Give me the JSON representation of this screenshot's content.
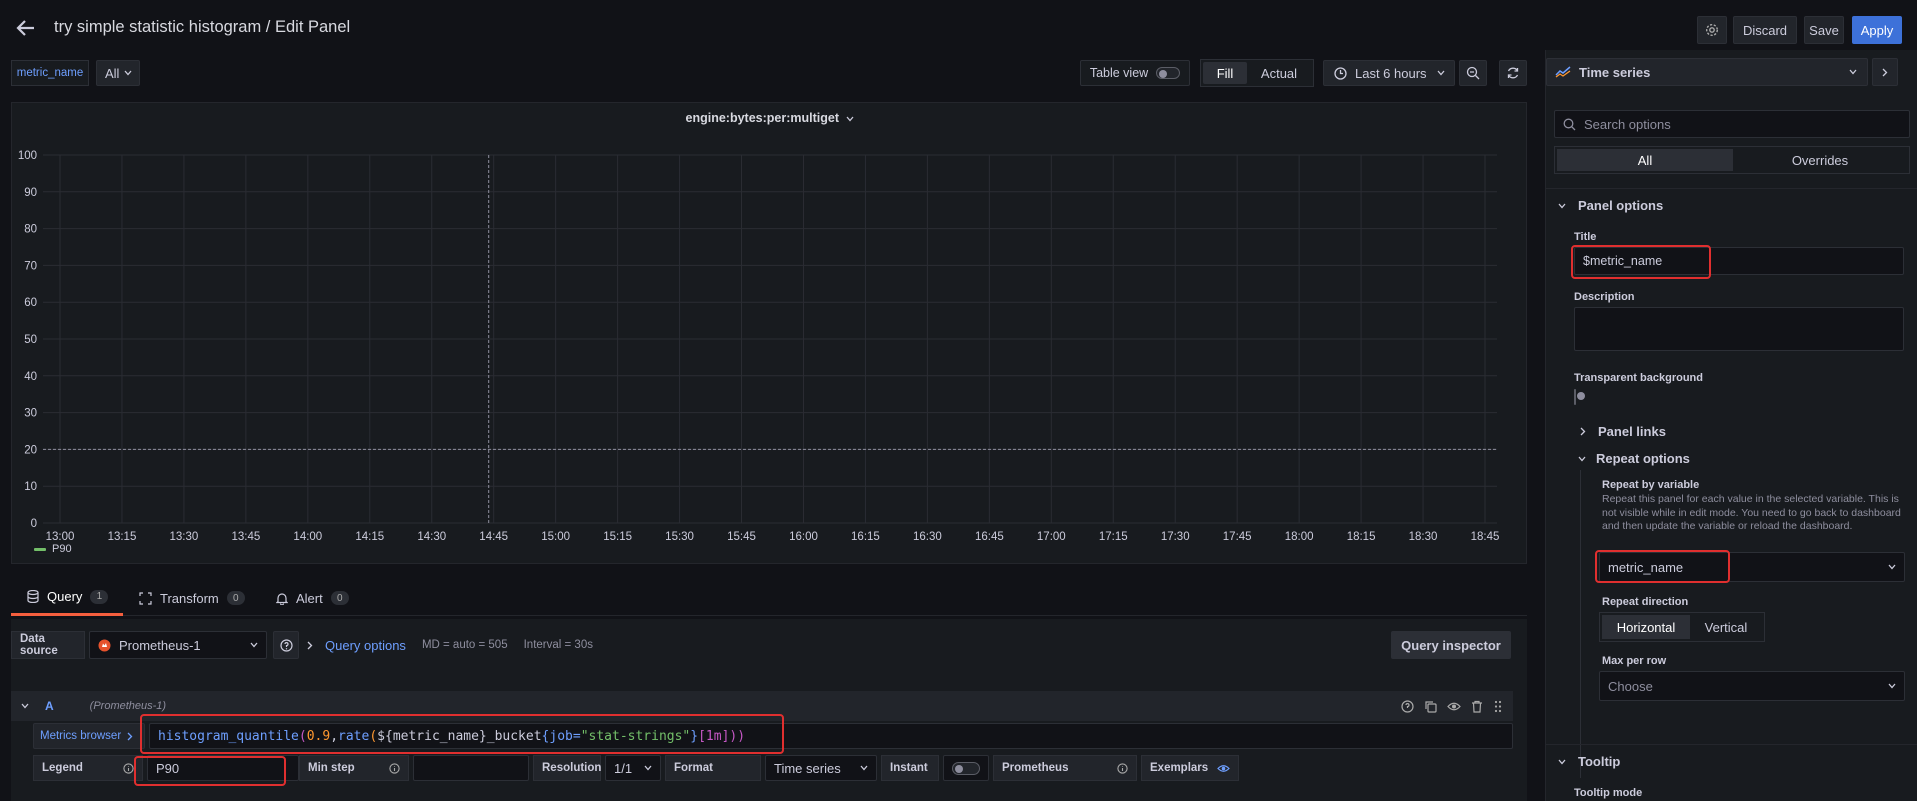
{
  "header": {
    "title": "try simple statistic histogram / Edit Panel",
    "discard": "Discard",
    "save": "Save",
    "apply": "Apply"
  },
  "variable": {
    "label": "metric_name",
    "value": "All"
  },
  "toolbar": {
    "table_view": "Table view",
    "fill": "Fill",
    "actual": "Actual",
    "time_range": "Last 6 hours"
  },
  "panel": {
    "title": "engine:bytes:per:multiget",
    "legend_item": "P90"
  },
  "chart_data": {
    "type": "line",
    "title": "engine:bytes:per:multiget",
    "ylim": [
      0,
      100
    ],
    "y_ticks": [
      "100",
      "90",
      "80",
      "70",
      "60",
      "50",
      "40",
      "30",
      "20",
      "10",
      "0"
    ],
    "x_ticks": [
      "13:00",
      "13:15",
      "13:30",
      "13:45",
      "14:00",
      "14:15",
      "14:30",
      "14:45",
      "15:00",
      "15:15",
      "15:30",
      "15:45",
      "16:00",
      "16:15",
      "16:30",
      "16:45",
      "17:00",
      "17:15",
      "17:30",
      "17:45",
      "18:00",
      "18:15",
      "18:30",
      "18:45"
    ],
    "series": [
      {
        "name": "P90",
        "values": []
      }
    ],
    "legend": "bottom-left",
    "grid": true,
    "color": "#73bf69"
  },
  "tabs": {
    "query": "Query",
    "query_count": "1",
    "transform": "Transform",
    "transform_count": "0",
    "alert": "Alert",
    "alert_count": "0"
  },
  "query_bar": {
    "ds_label": "Data source",
    "ds_value": "Prometheus-1",
    "query_options": "Query options",
    "md": "MD = auto = 505",
    "interval": "Interval = 30s",
    "inspector": "Query inspector"
  },
  "query_row": {
    "ref": "A",
    "ds": "(Prometheus-1)",
    "metrics_browser": "Metrics browser",
    "expr": {
      "fn": "histogram_quantile",
      "p1": "(",
      "num": "0.9",
      "comma": ",",
      "fn2": "rate",
      "p2": "(",
      "var": "${metric_name}",
      "suffix": "_bucket",
      "b1": "{",
      "lbl": "job=",
      "str": "\"stat-strings\"",
      "b2": "}",
      "range": "[1m]",
      "close": "))"
    },
    "legend_label": "Legend",
    "legend_value": "P90",
    "min_step_label": "Min step",
    "resolution_label": "Resolution",
    "resolution_value": "1/1",
    "format_label": "Format",
    "format_value": "Time series",
    "instant_label": "Instant",
    "prometheus_label": "Prometheus",
    "exemplars_label": "Exemplars"
  },
  "options": {
    "viz": "Time series",
    "search_placeholder": "Search options",
    "all": "All",
    "overrides": "Overrides",
    "panel_options": "Panel options",
    "title_label": "Title",
    "title_value": "$metric_name",
    "description_label": "Description",
    "transparent_label": "Transparent background",
    "panel_links": "Panel links",
    "repeat_options": "Repeat options",
    "repeat_by_label": "Repeat by variable",
    "repeat_desc": "Repeat this panel for each value in the selected variable. This is not visible while in edit mode. You need to go back to dashboard and then update the variable or reload the dashboard.",
    "repeat_value": "metric_name",
    "direction_label": "Repeat direction",
    "horizontal": "Horizontal",
    "vertical": "Vertical",
    "max_per_row_label": "Max per row",
    "max_per_row_value": "Choose",
    "tooltip": "Tooltip",
    "tooltip_mode": "Tooltip mode"
  }
}
